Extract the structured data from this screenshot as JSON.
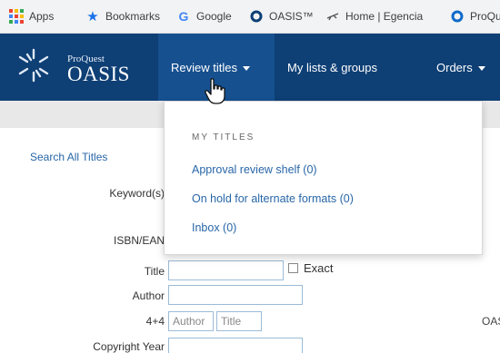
{
  "bookmarks": [
    {
      "label": "Apps",
      "icon": "apps-grid-icon"
    },
    {
      "label": "Bookmarks",
      "icon": "star-icon"
    },
    {
      "label": "Google",
      "icon": "google-g-icon"
    },
    {
      "label": "OASIS™",
      "icon": "oasis-circle-icon"
    },
    {
      "label": "Home | Egencia",
      "icon": "plane-icon"
    },
    {
      "label": "ProQu",
      "icon": "oasis-circle-icon"
    }
  ],
  "logo": {
    "brand": "ProQuest",
    "product": "OASIS"
  },
  "nav": {
    "review_titles": "Review titles",
    "my_lists": "My lists & groups",
    "orders": "Orders"
  },
  "dropdown": {
    "heading": "MY TITLES",
    "items": [
      "Approval review shelf (0)",
      "On hold for alternate formats (0)",
      "Inbox (0)"
    ]
  },
  "search": {
    "search_all": "Search All Titles",
    "keyword_label": "Keyword(s)",
    "isbn_label": "ISBN/EAN",
    "title_label": "Title",
    "exact_label": "Exact",
    "author_label": "Author",
    "four_four_label": "4+4",
    "author_placeholder": "Author",
    "title_placeholder": "Title",
    "copyright_label": "Copyright Year",
    "side_text": "OAS"
  },
  "colors": {
    "nav_bg": "#0e3f75",
    "nav_active_bg": "#16508f",
    "link": "#2866a8",
    "input_border": "#9bbbd8"
  }
}
